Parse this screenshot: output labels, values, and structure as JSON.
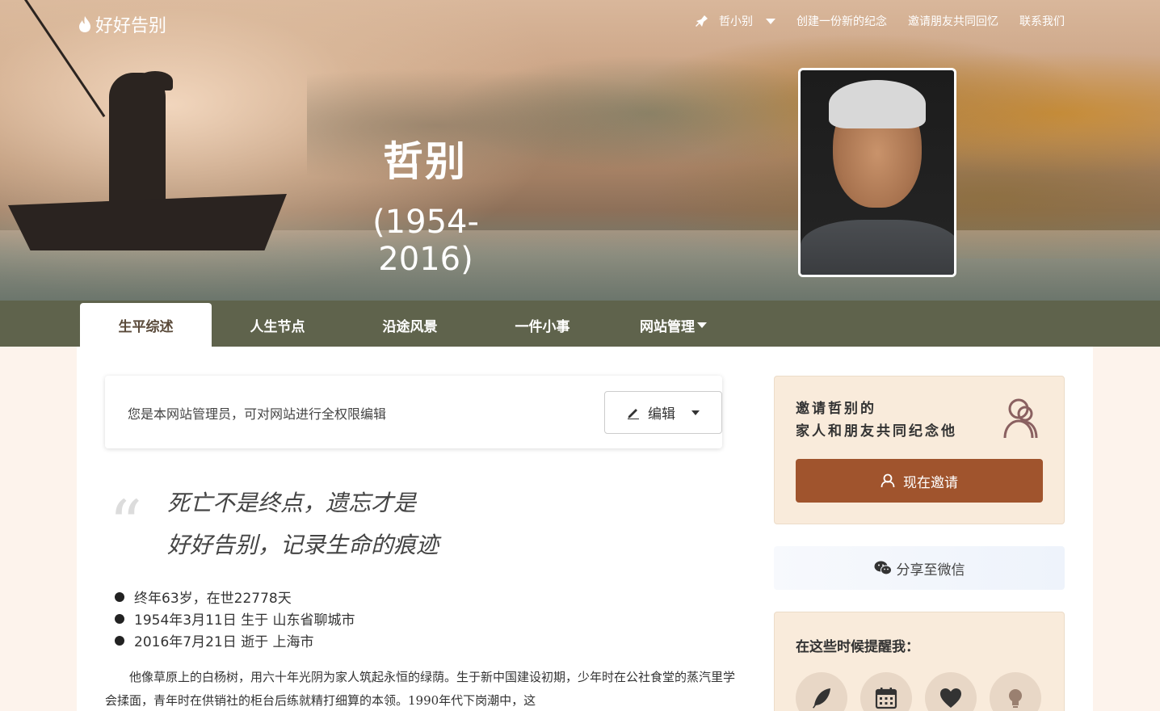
{
  "header": {
    "logo_text": "好好告别",
    "user_name": "哲小别",
    "nav": [
      "创建一份新的纪念",
      "邀请朋友共同回忆",
      "联系我们"
    ]
  },
  "memorial": {
    "name": "哲别",
    "years": "(1954-2016)"
  },
  "tabs": [
    {
      "label": "生平综述"
    },
    {
      "label": "人生节点"
    },
    {
      "label": "沿途风景"
    },
    {
      "label": "一件小事"
    },
    {
      "label": "网站管理"
    }
  ],
  "admin": {
    "notice": "您是本网站管理员，可对网站进行全权限编辑",
    "edit_label": "编辑"
  },
  "quote": {
    "line1": "死亡不是终点，遗忘才是",
    "line2": "好好告别，记录生命的痕迹"
  },
  "facts": [
    "终年63岁，在世22778天",
    "1954年3月11日 生于 山东省聊城市",
    "2016年7月21日 逝于 上海市"
  ],
  "bio": "他像草原上的白杨树，用六十年光阴为家人筑起永恒的绿荫。生于新中国建设初期，少年时在公社食堂的蒸汽里学会揉面，青年时在供销社的柜台后练就精打细算的本领。1990年代下岗潮中，这",
  "sidebar": {
    "invite_line1": "邀请哲别的",
    "invite_line2": "家人和朋友共同纪念他",
    "invite_button": "现在邀请",
    "wechat_button": "分享至微信",
    "remind_title": "在这些时候提醒我："
  },
  "colors": {
    "tabbar": "#5f634c",
    "accent": "#a0542d",
    "card_bg": "#f9ebdb"
  }
}
